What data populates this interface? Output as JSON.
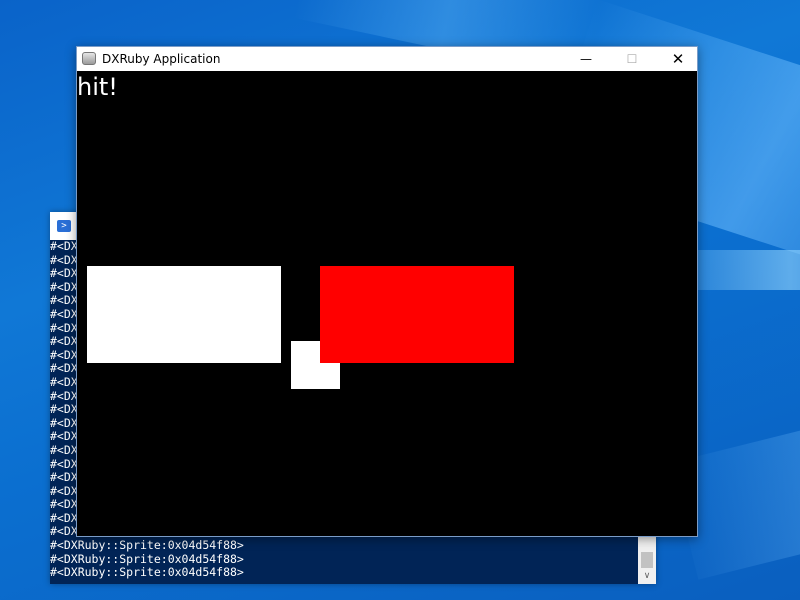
{
  "console": {
    "icon": "powershell-icon",
    "visible_line_prefix": "#<DX",
    "hidden_lines_count": 22,
    "lines": [
      "#<DXRuby::Sprite:0x04d54f88>",
      "#<DXRuby::Sprite:0x04d54f88>",
      "#<DXRuby::Sprite:0x04d54f88>"
    ],
    "background_color": "#012456"
  },
  "dx_window": {
    "title": "DXRuby Application",
    "icon": "app-icon",
    "controls": {
      "minimize": "—",
      "maximize": "☐",
      "close": "✕"
    }
  },
  "game": {
    "message": "hit!",
    "background_color": "#000000",
    "sprites": [
      {
        "name": "white-block-large",
        "color": "#ffffff"
      },
      {
        "name": "white-block-small",
        "color": "#ffffff"
      },
      {
        "name": "red-block",
        "color": "#ff0000"
      }
    ]
  }
}
